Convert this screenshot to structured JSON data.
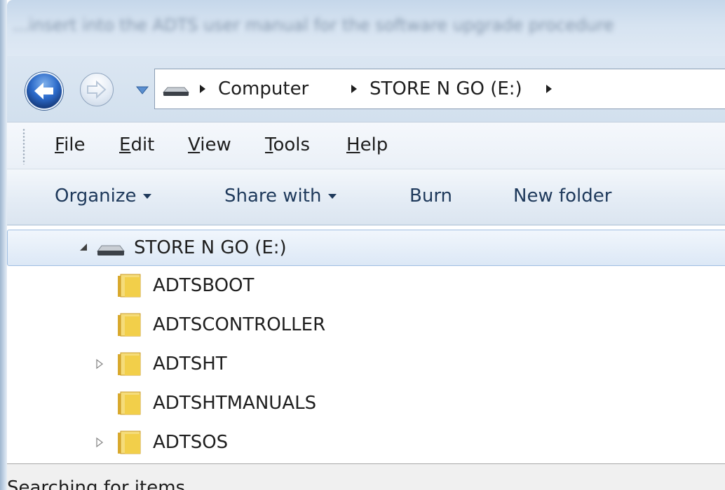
{
  "window": {
    "title": "...insert into the ADTS user manual for the software upgrade procedure"
  },
  "navigation": {
    "back_icon": "back-arrow-icon",
    "forward_icon": "forward-arrow-icon",
    "recent_pages_icon": "chevron-down-icon",
    "breadcrumbs": [
      {
        "label": "Computer"
      },
      {
        "label": "STORE N GO (E:)"
      }
    ]
  },
  "menu": {
    "items": [
      {
        "label": "File"
      },
      {
        "label": "Edit"
      },
      {
        "label": "View"
      },
      {
        "label": "Tools"
      },
      {
        "label": "Help"
      }
    ]
  },
  "commands": {
    "organize": "Organize",
    "share_with": "Share with",
    "burn": "Burn",
    "new_folder": "New folder"
  },
  "tree": {
    "drive": {
      "label": "STORE N GO (E:)",
      "icon": "removable-drive-icon",
      "expanded": true
    },
    "folders": [
      {
        "name": "ADTSBOOT",
        "expandable": false
      },
      {
        "name": "ADTSCONTROLLER",
        "expandable": false
      },
      {
        "name": "ADTSHT",
        "expandable": true
      },
      {
        "name": "ADTSHTMANUALS",
        "expandable": false
      },
      {
        "name": "ADTSOS",
        "expandable": true
      }
    ]
  },
  "status": {
    "text": "Searching for items..."
  },
  "colors": {
    "selection_border": "#9dbde1",
    "command_text": "#1e395b",
    "folder_yellow": "#f2cf4a"
  }
}
